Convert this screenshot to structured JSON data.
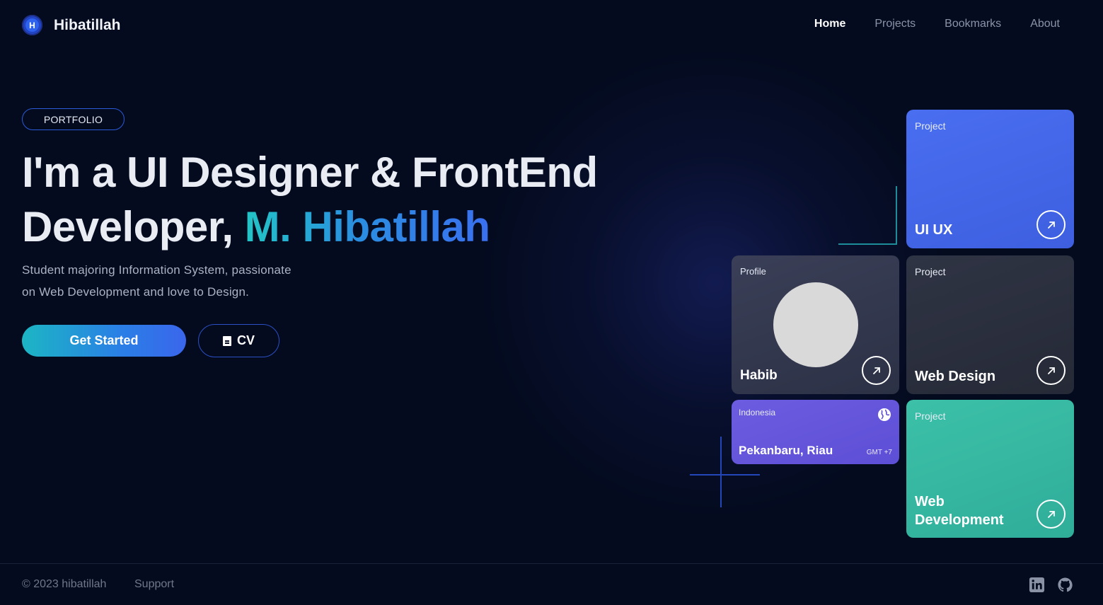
{
  "brand": {
    "logo_letter": "H",
    "name": "Hibatillah"
  },
  "nav": {
    "items": [
      "Home",
      "Projects",
      "Bookmarks",
      "About"
    ],
    "active": "Home"
  },
  "hero": {
    "badge": "PORTFOLIO",
    "headline_line1": "I'm a UI Designer & FrontEnd",
    "headline_line2_prefix": "Developer, ",
    "headline_name": "M. Hibatillah",
    "subtitle_line1": "Student majoring Information System, passionate",
    "subtitle_line2": "on Web Development and love to Design.",
    "primary_button": "Get Started",
    "cv_button": "CV"
  },
  "cards": {
    "uiux": {
      "kicker": "Project",
      "title": "UI UX"
    },
    "profile": {
      "kicker": "Profile",
      "title": "Habib"
    },
    "webdesign": {
      "kicker": "Project",
      "title": "Web Design"
    },
    "location": {
      "country": "Indonesia",
      "city": "Pekanbaru, Riau",
      "timezone": "GMT +7"
    },
    "webdev": {
      "kicker": "Project",
      "title_line1": "Web",
      "title_line2": "Development"
    }
  },
  "footer": {
    "copyright": "© 2023 hibatillah",
    "support": "Support"
  },
  "colors": {
    "background": "#040b1f",
    "accent_blue": "#3d5fe0",
    "accent_teal": "#2fae9a",
    "accent_purple": "#5d4fd6"
  },
  "icons": [
    "file-icon",
    "arrow-up-right-icon",
    "globe-icon",
    "linkedin-icon",
    "github-icon"
  ]
}
